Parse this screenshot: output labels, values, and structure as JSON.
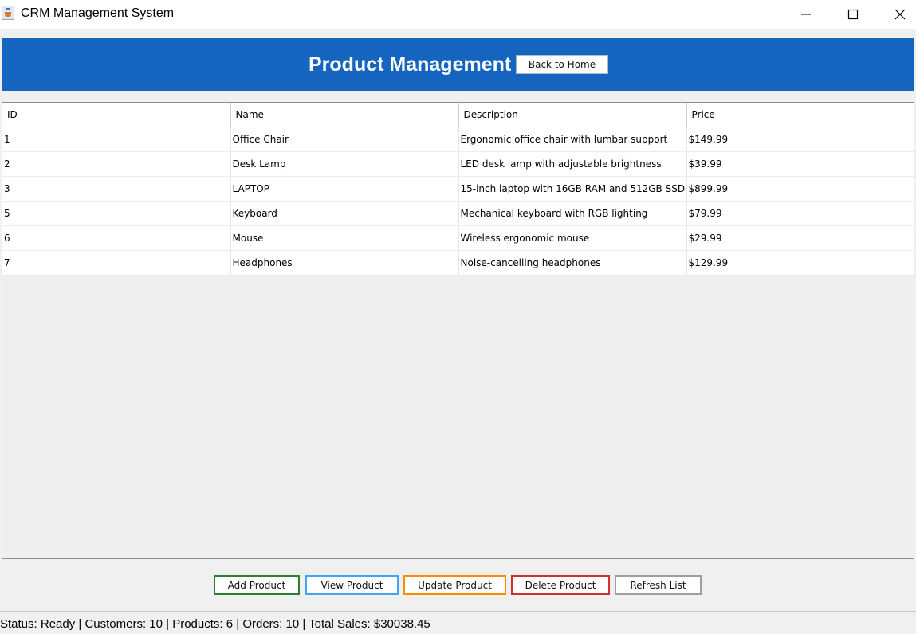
{
  "window": {
    "title": "CRM Management System"
  },
  "header": {
    "title": "Product Management",
    "back_button": "Back to Home"
  },
  "table": {
    "columns": [
      "ID",
      "Name",
      "Description",
      "Price"
    ],
    "rows": [
      [
        "1",
        "Office Chair",
        "Ergonomic office chair with lumbar support",
        "$149.99"
      ],
      [
        "2",
        "Desk Lamp",
        "LED desk lamp with adjustable brightness",
        "$39.99"
      ],
      [
        "3",
        "LAPTOP",
        "15-inch laptop with 16GB RAM and 512GB SSD",
        "$899.99"
      ],
      [
        "5",
        "Keyboard",
        "Mechanical keyboard with RGB lighting",
        "$79.99"
      ],
      [
        "6",
        "Mouse",
        "Wireless ergonomic mouse",
        "$29.99"
      ],
      [
        "7",
        "Headphones",
        "Noise-cancelling headphones",
        "$129.99"
      ]
    ]
  },
  "actions": {
    "add": "Add Product",
    "view": "View Product",
    "update": "Update Product",
    "delete": "Delete Product",
    "refresh": "Refresh List"
  },
  "status": {
    "text": "Status: Ready | Customers: 10 | Products: 6 | Orders: 10 | Total Sales: $30038.45"
  },
  "colors": {
    "header_bg": "#1565c0",
    "add_border": "#2e7d32",
    "view_border": "#42a5f5",
    "update_border": "#fb8c00",
    "delete_border": "#d32f2f",
    "refresh_border": "#9e9e9e"
  },
  "icons": {
    "app": "java-app-icon",
    "minimize": "minimize-icon",
    "maximize": "maximize-icon",
    "close": "close-icon"
  }
}
